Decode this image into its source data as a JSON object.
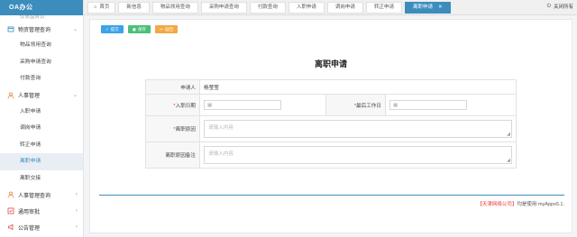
{
  "app": {
    "logo": "OA办公"
  },
  "sidebar": {
    "partial_top": "仪表盘首页",
    "groups": [
      {
        "label": "物资管理查询",
        "icon": "box-icon",
        "expanded": true,
        "items": [
          {
            "label": "物品领用查询"
          },
          {
            "label": "采购申请查询"
          },
          {
            "label": "付款查询"
          }
        ]
      },
      {
        "label": "人事管理",
        "icon": "person-icon",
        "expanded": true,
        "items": [
          {
            "label": "入职申请"
          },
          {
            "label": "调岗申请"
          },
          {
            "label": "转正申请"
          },
          {
            "label": "离职申请",
            "active": true
          },
          {
            "label": "离职交接"
          }
        ]
      },
      {
        "label": "人事管理查询",
        "icon": "person-search-icon",
        "expanded": false
      },
      {
        "label": "通用审批",
        "icon": "approval-icon",
        "expanded": false
      },
      {
        "label": "公告管理",
        "icon": "notice-icon",
        "expanded": false
      }
    ]
  },
  "tabs": {
    "home": "首页",
    "items": [
      "新信息",
      "物品领用查询",
      "采购申请查询",
      "付款查询",
      "入职申请",
      "调岗申请",
      "转正申请"
    ],
    "active": "离职申请",
    "close_all": "关闭所有"
  },
  "toolbar": {
    "submit": "提交",
    "save": "保存",
    "back": "返回"
  },
  "form": {
    "title": "离职申请",
    "applicant_label": "申请人",
    "applicant_value": "杨莹莹",
    "entry_date_label": "入职日期",
    "last_work_date_label": "最后工作日",
    "reason_label": "离职原因",
    "reason_placeholder": "请输入内容",
    "remark_label": "离职原因备注",
    "remark_placeholder": "请输入内容"
  },
  "footer": {
    "company": "【天津网络公司】",
    "text": "均是使用:myApps5.1."
  },
  "colors": {
    "accent": "#3c8dbc",
    "required": "#e33333",
    "submit": "#3ba3ea",
    "save": "#4cbf7a",
    "back": "#f2a943"
  }
}
